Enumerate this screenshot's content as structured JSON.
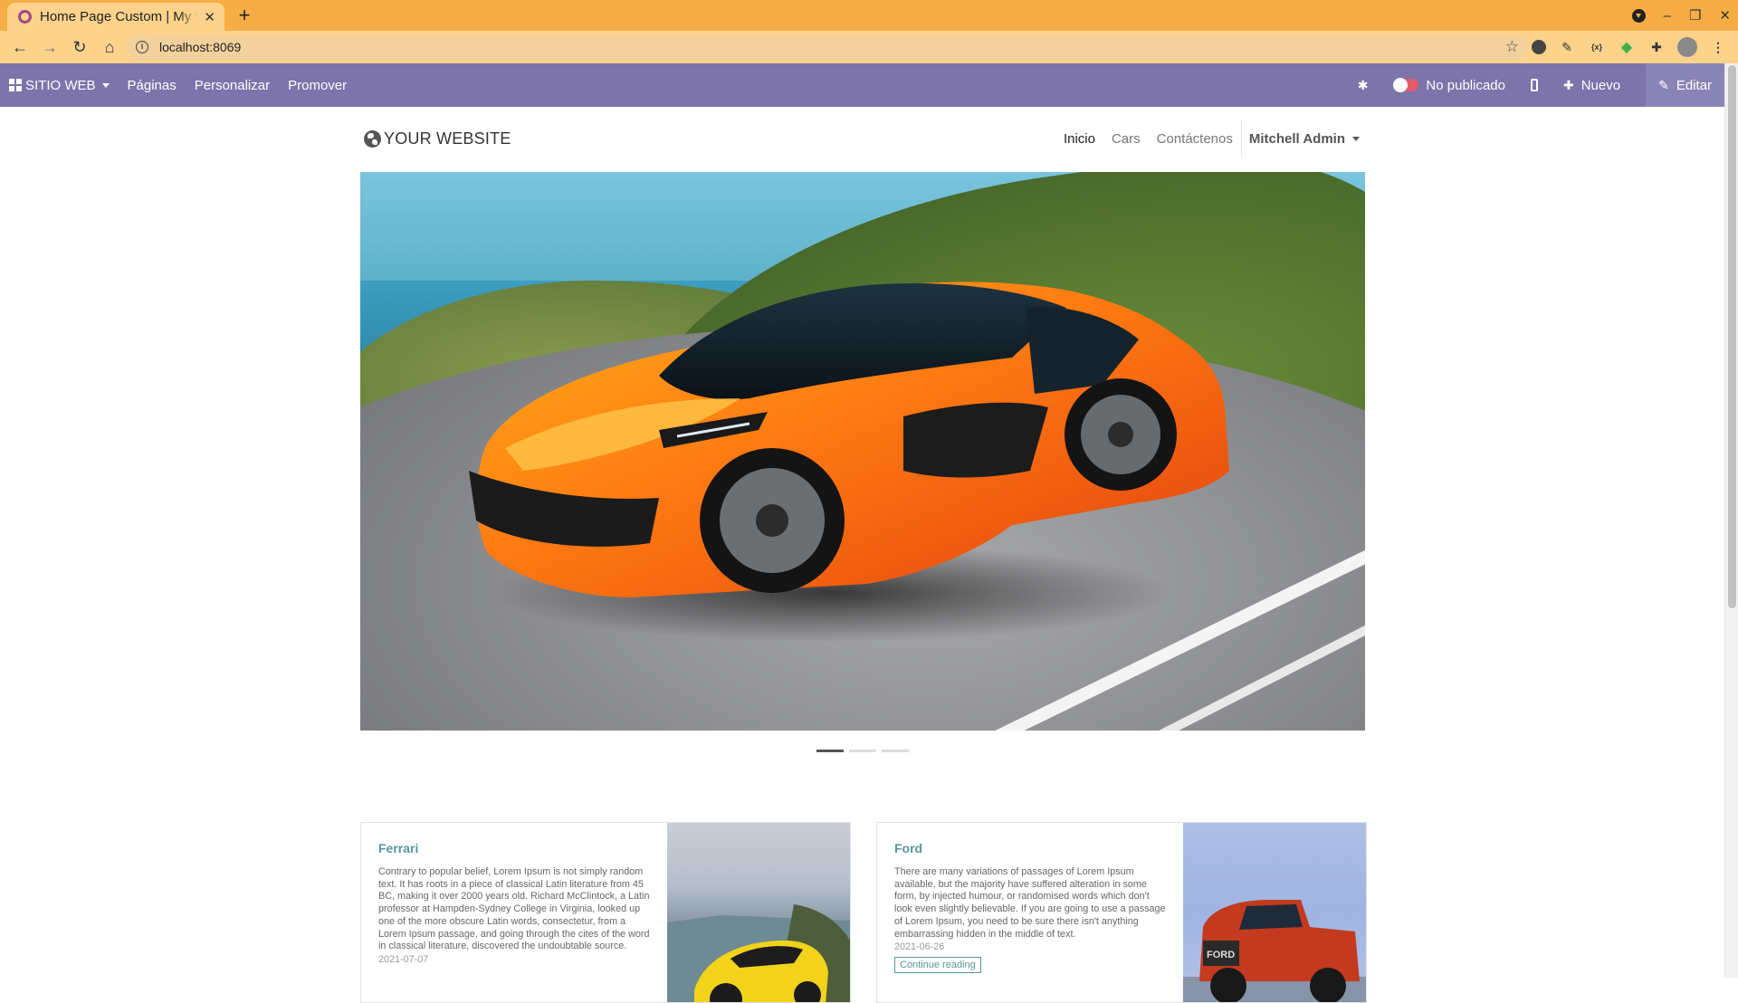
{
  "browser": {
    "tab_title": "Home Page Custom | My Website",
    "new_tab": "+",
    "url": "localhost:8069"
  },
  "admin_bar": {
    "brand": "SITIO WEB",
    "menus": [
      "Páginas",
      "Personalizar",
      "Promover"
    ],
    "publish_status": "No publicado",
    "new_label": "Nuevo",
    "edit_label": "Editar"
  },
  "site": {
    "logo_text": "YOUR WEBSITE",
    "nav": [
      "Inicio",
      "Cars",
      "Contáctenos"
    ],
    "user": "Mitchell Admin"
  },
  "carousel": {
    "slide_count": 3,
    "active_index": 0
  },
  "posts": [
    {
      "title": "Ferrari",
      "text": "Contrary to popular belief, Lorem Ipsum is not simply random text. It has roots in a piece of classical Latin literature from 45 BC, making it over 2000 years old. Richard McClintock, a Latin professor at Hampden-Sydney College in Virginia, looked up one of the more obscure Latin words, consectetur, from a Lorem Ipsum passage, and going through the cites of the word in classical literature, discovered the undoubtable source.",
      "date": "2021-07-07"
    },
    {
      "title": "Ford",
      "text": "There are many variations of passages of Lorem Ipsum available, but the majority have suffered alteration in some form, by injected humour, or randomised words which don't look even slightly believable. If you are going to use a passage of Lorem Ipsum, you need to be sure there isn't anything embarrassing hidden in the middle of text.",
      "date": "2021-06-26",
      "button": "Continue reading"
    }
  ],
  "colors": {
    "admin_bar": "#7c74aa",
    "browser_frame": "#f6ad45",
    "accent": "#58979b",
    "toggle_off": "#e55b6b"
  }
}
